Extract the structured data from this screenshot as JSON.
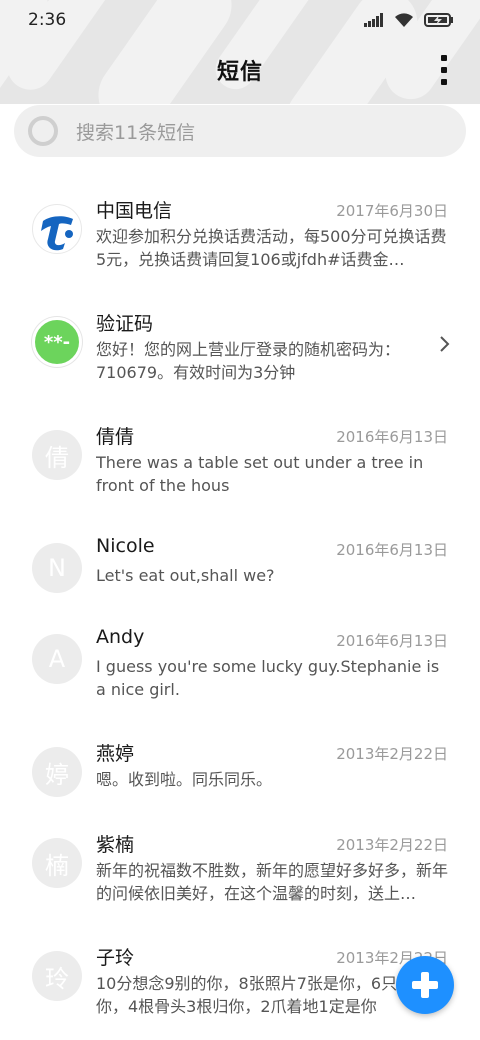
{
  "status_bar": {
    "time": "2:36",
    "icons": [
      "signal-icon",
      "wifi-icon",
      "battery-charging-icon"
    ]
  },
  "header": {
    "title": "短信",
    "more_icon": "more-vertical-icon"
  },
  "search": {
    "placeholder": "搜索11条短信",
    "icon": "search-icon"
  },
  "conversations": [
    {
      "name": "中国电信",
      "date": "2017年6月30日",
      "preview": "欢迎参加积分兑换话费活动，每500分可兑换话费5元，兑换话费请回复106或jfdh#话费金…",
      "avatar": "china-telecom-logo"
    },
    {
      "name": "验证码",
      "date": "",
      "preview": "您好！您的网上营业厅登录的随机密码为：710679。有效时间为3分钟",
      "avatar": "verification-code-icon",
      "avatar_text": "**-"
    },
    {
      "name": "倩倩",
      "date": "2016年6月13日",
      "preview": "There was a table set out under a tree in front of the hous",
      "avatar_text": "倩"
    },
    {
      "name": "Nicole",
      "date": "2016年6月13日",
      "preview": "Let's eat out,shall we?",
      "avatar_text": "N"
    },
    {
      "name": "Andy",
      "date": "2016年6月13日",
      "preview": "I guess you're some lucky guy.Stephanie is a nice girl.",
      "avatar_text": "A"
    },
    {
      "name": "燕婷",
      "date": "2013年2月22日",
      "preview": "嗯。收到啦。同乐同乐。",
      "avatar_text": "婷"
    },
    {
      "name": "紫楠",
      "date": "2013年2月22日",
      "preview": "新年的祝福数不胜数，新年的愿望好多好多，新年的问候依旧美好，在这个温馨的时刻，送上…",
      "avatar_text": "楠"
    },
    {
      "name": "子玲",
      "date": "2013年2月22日",
      "preview": "10分想念9别的你，8张照片7张是你，6只只像你，4根骨头3根归你，2爪着地1定是你",
      "avatar_text": "玲"
    }
  ],
  "fab": {
    "icon": "plus-icon"
  },
  "colors": {
    "accent": "#1e90ff",
    "verify_green": "#6cd45c",
    "telecom_blue": "#1565c0"
  }
}
